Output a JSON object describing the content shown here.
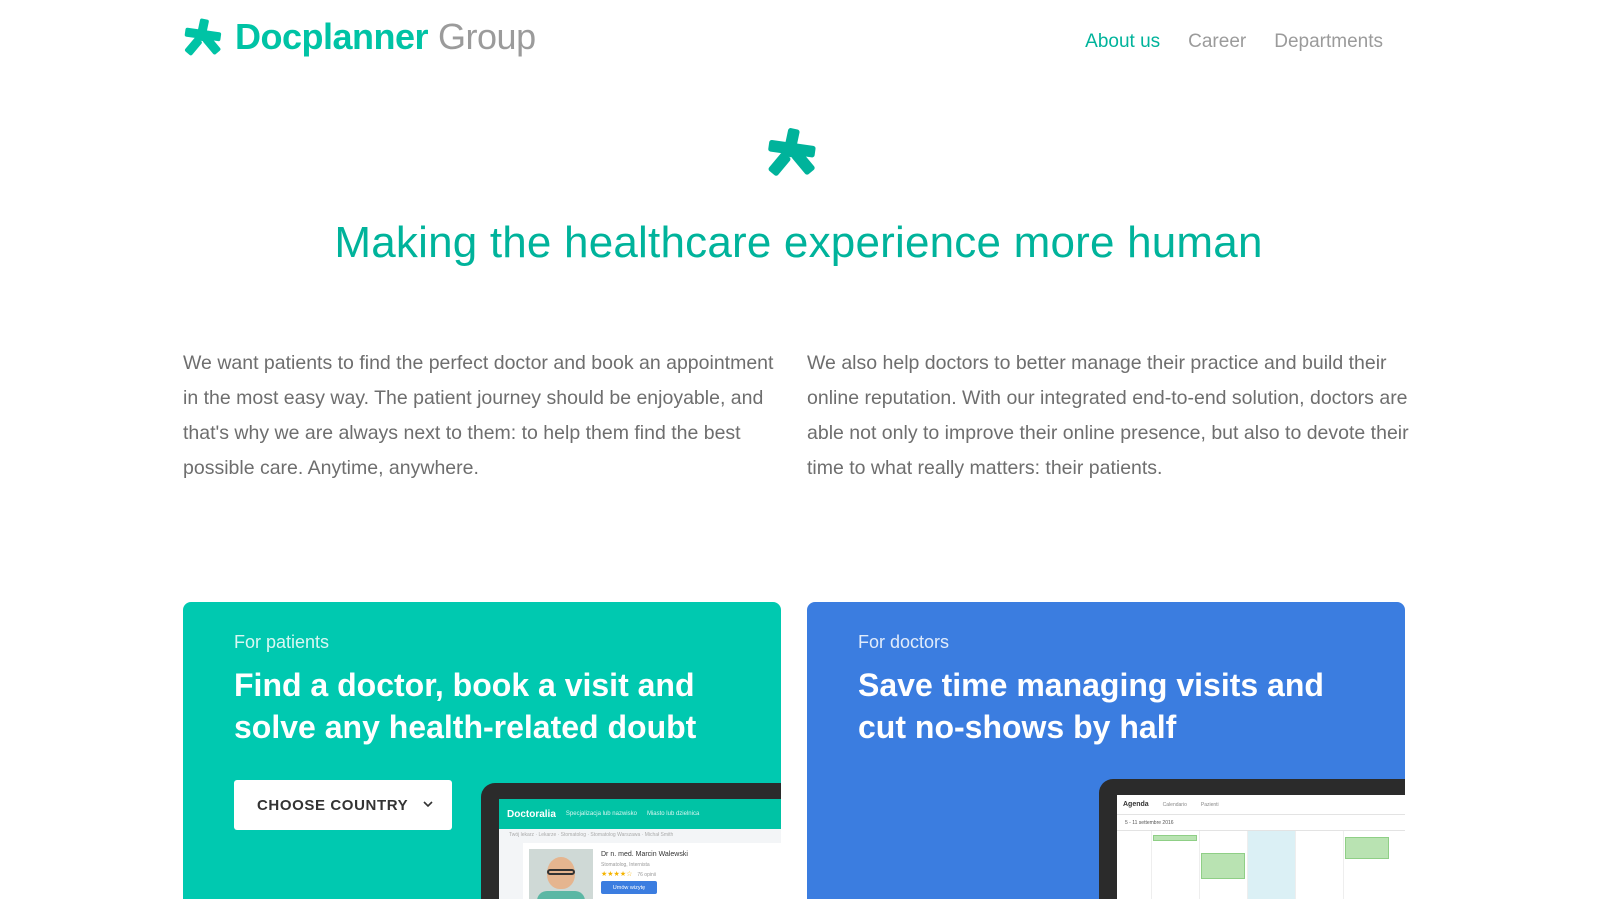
{
  "header": {
    "brand": "Docplanner",
    "brand_suffix": "Group",
    "nav": [
      {
        "label": "About us",
        "active": true
      },
      {
        "label": "Career",
        "active": false
      },
      {
        "label": "Departments",
        "active": false
      }
    ]
  },
  "hero": {
    "title": "Making the healthcare experience more human"
  },
  "intro": {
    "left": "We want patients to find the perfect doctor and book an appointment in the most easy way. The patient journey should be enjoyable, and that's why we are always next to them: to help them find the best possible care. Anytime, anywhere.",
    "right": "We also help doctors to better manage their practice and build their online reputation. With our integrated end-to-end solution, doctors are able not only to improve their online presence, but also to devote their time to what really matters: their patients."
  },
  "cards": {
    "patients": {
      "kicker": "For patients",
      "title": "Find a doctor, book a visit and solve any health-related doubt",
      "cta": "CHOOSE COUNTRY",
      "mock": {
        "brand": "Doctoralia",
        "menu_1": "Specjalizacja lub nazwisko",
        "menu_2": "Miasto lub dzielnica",
        "crumbs": "Twój lekarz · Lekarze · Stomatolog · Stomatolog Warszawa · Michał Smith",
        "doctor_name": "Dr n. med. Marcin Walewski",
        "doctor_spec": "Stomatolog, Internista",
        "stars": "★★★★☆",
        "reviews": "76 opinii",
        "book": "Umów wizytę"
      }
    },
    "doctors": {
      "kicker": "For doctors",
      "title": "Save time managing visits and cut no-shows by half",
      "mock": {
        "title": "Agenda",
        "tab_1": "Calendario",
        "tab_2": "Pazienti",
        "week": "5 - 11 settembre 2016"
      }
    }
  },
  "colors": {
    "brand_teal": "#00c3a5",
    "patients_card": "#00c9b0",
    "doctors_card": "#3b7de0",
    "nav_inactive": "#9b9b9b"
  },
  "icons": {
    "logo": "docplanner-star-icon",
    "dropdown": "chevron-down-icon"
  }
}
